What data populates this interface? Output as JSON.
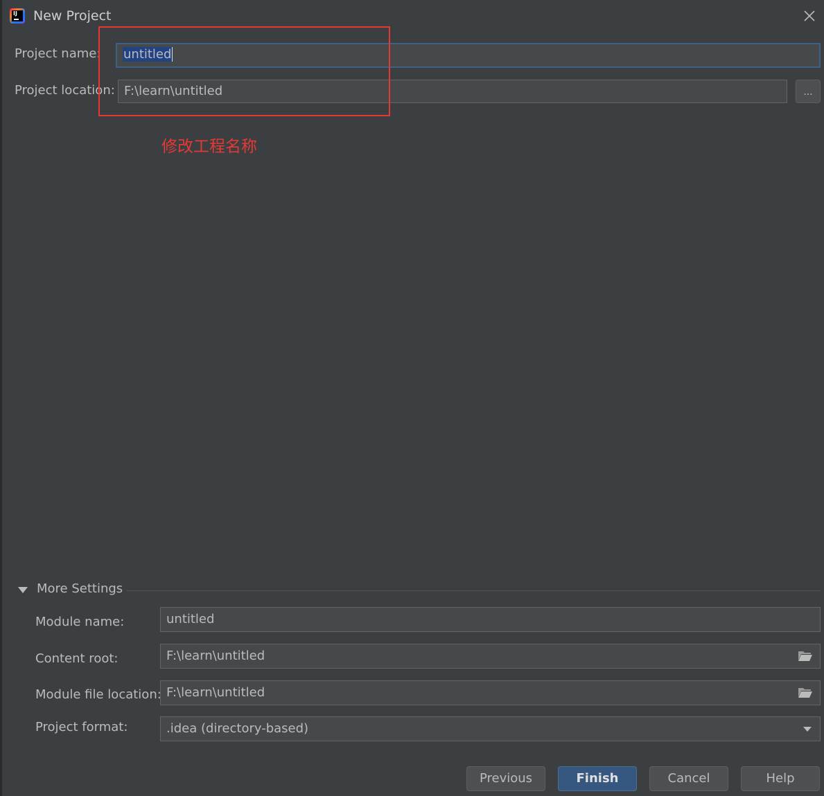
{
  "window": {
    "title": "New Project",
    "app_icon": "intellij-idea-icon",
    "close_icon": "close-icon"
  },
  "top_form": {
    "project_name_label": "Project name:",
    "project_name_value": "untitled",
    "project_location_label": "Project location:",
    "project_location_value": "F:\\learn\\untitled",
    "browse_label": "..."
  },
  "annotation": {
    "text": "修改工程名称",
    "color": "#e53935"
  },
  "more_settings": {
    "label": "More Settings",
    "module_name_label": "Module name:",
    "module_name_value": "untitled",
    "content_root_label": "Content root:",
    "content_root_value": "F:\\learn\\untitled",
    "module_file_location_label": "Module file location:",
    "module_file_location_value": "F:\\learn\\untitled",
    "project_format_label": "Project format:",
    "project_format_value": ".idea (directory-based)"
  },
  "buttons": {
    "previous": "Previous",
    "finish": "Finish",
    "cancel": "Cancel",
    "help": "Help"
  },
  "colors": {
    "background": "#3c3f41",
    "field_background": "#45494a",
    "selection": "#214283",
    "primary_button": "#365880"
  }
}
